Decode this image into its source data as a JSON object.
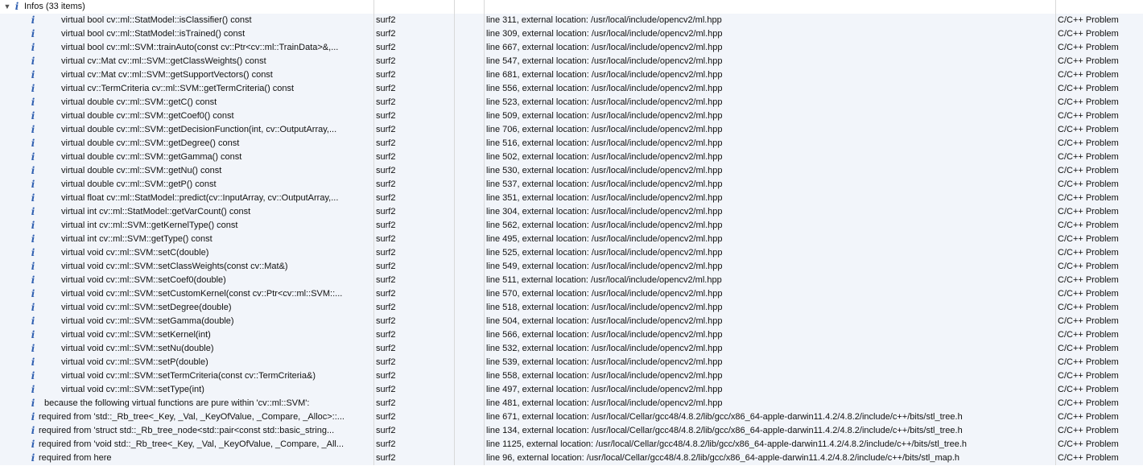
{
  "group": {
    "icon": "info-icon",
    "label": "Infos (33 items)",
    "expanded": true
  },
  "items": [
    {
      "description": "virtual bool cv::ml::StatModel::isClassifier() const",
      "resource": "surf2",
      "path": "",
      "location": "line 311, external location: /usr/local/include/opencv2/ml.hpp",
      "type": "C/C++ Problem",
      "indent": 2
    },
    {
      "description": "virtual bool cv::ml::StatModel::isTrained() const",
      "resource": "surf2",
      "path": "",
      "location": "line 309, external location: /usr/local/include/opencv2/ml.hpp",
      "type": "C/C++ Problem",
      "indent": 2
    },
    {
      "description": "virtual bool cv::ml::SVM::trainAuto(const cv::Ptr<cv::ml::TrainData>&,...",
      "resource": "surf2",
      "path": "",
      "location": "line 667, external location: /usr/local/include/opencv2/ml.hpp",
      "type": "C/C++ Problem",
      "indent": 2
    },
    {
      "description": "virtual cv::Mat cv::ml::SVM::getClassWeights() const",
      "resource": "surf2",
      "path": "",
      "location": "line 547, external location: /usr/local/include/opencv2/ml.hpp",
      "type": "C/C++ Problem",
      "indent": 2
    },
    {
      "description": "virtual cv::Mat cv::ml::SVM::getSupportVectors() const",
      "resource": "surf2",
      "path": "",
      "location": "line 681, external location: /usr/local/include/opencv2/ml.hpp",
      "type": "C/C++ Problem",
      "indent": 2
    },
    {
      "description": "virtual cv::TermCriteria cv::ml::SVM::getTermCriteria() const",
      "resource": "surf2",
      "path": "",
      "location": "line 556, external location: /usr/local/include/opencv2/ml.hpp",
      "type": "C/C++ Problem",
      "indent": 2
    },
    {
      "description": "virtual double cv::ml::SVM::getC() const",
      "resource": "surf2",
      "path": "",
      "location": "line 523, external location: /usr/local/include/opencv2/ml.hpp",
      "type": "C/C++ Problem",
      "indent": 2
    },
    {
      "description": "virtual double cv::ml::SVM::getCoef0() const",
      "resource": "surf2",
      "path": "",
      "location": "line 509, external location: /usr/local/include/opencv2/ml.hpp",
      "type": "C/C++ Problem",
      "indent": 2
    },
    {
      "description": "virtual double cv::ml::SVM::getDecisionFunction(int, cv::OutputArray,...",
      "resource": "surf2",
      "path": "",
      "location": "line 706, external location: /usr/local/include/opencv2/ml.hpp",
      "type": "C/C++ Problem",
      "indent": 2
    },
    {
      "description": "virtual double cv::ml::SVM::getDegree() const",
      "resource": "surf2",
      "path": "",
      "location": "line 516, external location: /usr/local/include/opencv2/ml.hpp",
      "type": "C/C++ Problem",
      "indent": 2
    },
    {
      "description": "virtual double cv::ml::SVM::getGamma() const",
      "resource": "surf2",
      "path": "",
      "location": "line 502, external location: /usr/local/include/opencv2/ml.hpp",
      "type": "C/C++ Problem",
      "indent": 2
    },
    {
      "description": "virtual double cv::ml::SVM::getNu() const",
      "resource": "surf2",
      "path": "",
      "location": "line 530, external location: /usr/local/include/opencv2/ml.hpp",
      "type": "C/C++ Problem",
      "indent": 2
    },
    {
      "description": "virtual double cv::ml::SVM::getP() const",
      "resource": "surf2",
      "path": "",
      "location": "line 537, external location: /usr/local/include/opencv2/ml.hpp",
      "type": "C/C++ Problem",
      "indent": 2
    },
    {
      "description": "virtual float cv::ml::StatModel::predict(cv::InputArray, cv::OutputArray,...",
      "resource": "surf2",
      "path": "",
      "location": "line 351, external location: /usr/local/include/opencv2/ml.hpp",
      "type": "C/C++ Problem",
      "indent": 2
    },
    {
      "description": "virtual int cv::ml::StatModel::getVarCount() const",
      "resource": "surf2",
      "path": "",
      "location": "line 304, external location: /usr/local/include/opencv2/ml.hpp",
      "type": "C/C++ Problem",
      "indent": 2
    },
    {
      "description": "virtual int cv::ml::SVM::getKernelType() const",
      "resource": "surf2",
      "path": "",
      "location": "line 562, external location: /usr/local/include/opencv2/ml.hpp",
      "type": "C/C++ Problem",
      "indent": 2
    },
    {
      "description": "virtual int cv::ml::SVM::getType() const",
      "resource": "surf2",
      "path": "",
      "location": "line 495, external location: /usr/local/include/opencv2/ml.hpp",
      "type": "C/C++ Problem",
      "indent": 2
    },
    {
      "description": "virtual void cv::ml::SVM::setC(double)",
      "resource": "surf2",
      "path": "",
      "location": "line 525, external location: /usr/local/include/opencv2/ml.hpp",
      "type": "C/C++ Problem",
      "indent": 2
    },
    {
      "description": "virtual void cv::ml::SVM::setClassWeights(const cv::Mat&)",
      "resource": "surf2",
      "path": "",
      "location": "line 549, external location: /usr/local/include/opencv2/ml.hpp",
      "type": "C/C++ Problem",
      "indent": 2
    },
    {
      "description": "virtual void cv::ml::SVM::setCoef0(double)",
      "resource": "surf2",
      "path": "",
      "location": "line 511, external location: /usr/local/include/opencv2/ml.hpp",
      "type": "C/C++ Problem",
      "indent": 2
    },
    {
      "description": "virtual void cv::ml::SVM::setCustomKernel(const cv::Ptr<cv::ml::SVM::...",
      "resource": "surf2",
      "path": "",
      "location": "line 570, external location: /usr/local/include/opencv2/ml.hpp",
      "type": "C/C++ Problem",
      "indent": 2
    },
    {
      "description": "virtual void cv::ml::SVM::setDegree(double)",
      "resource": "surf2",
      "path": "",
      "location": "line 518, external location: /usr/local/include/opencv2/ml.hpp",
      "type": "C/C++ Problem",
      "indent": 2
    },
    {
      "description": "virtual void cv::ml::SVM::setGamma(double)",
      "resource": "surf2",
      "path": "",
      "location": "line 504, external location: /usr/local/include/opencv2/ml.hpp",
      "type": "C/C++ Problem",
      "indent": 2
    },
    {
      "description": "virtual void cv::ml::SVM::setKernel(int)",
      "resource": "surf2",
      "path": "",
      "location": "line 566, external location: /usr/local/include/opencv2/ml.hpp",
      "type": "C/C++ Problem",
      "indent": 2
    },
    {
      "description": "virtual void cv::ml::SVM::setNu(double)",
      "resource": "surf2",
      "path": "",
      "location": "line 532, external location: /usr/local/include/opencv2/ml.hpp",
      "type": "C/C++ Problem",
      "indent": 2
    },
    {
      "description": "virtual void cv::ml::SVM::setP(double)",
      "resource": "surf2",
      "path": "",
      "location": "line 539, external location: /usr/local/include/opencv2/ml.hpp",
      "type": "C/C++ Problem",
      "indent": 2
    },
    {
      "description": "virtual void cv::ml::SVM::setTermCriteria(const cv::TermCriteria&)",
      "resource": "surf2",
      "path": "",
      "location": "line 558, external location: /usr/local/include/opencv2/ml.hpp",
      "type": "C/C++ Problem",
      "indent": 2
    },
    {
      "description": "virtual void cv::ml::SVM::setType(int)",
      "resource": "surf2",
      "path": "",
      "location": "line 497, external location: /usr/local/include/opencv2/ml.hpp",
      "type": "C/C++ Problem",
      "indent": 2
    },
    {
      "description": "because the following virtual functions are pure within 'cv::ml::SVM':",
      "resource": "surf2",
      "path": "",
      "location": "line 481, external location: /usr/local/include/opencv2/ml.hpp",
      "type": "C/C++ Problem",
      "indent": 1
    },
    {
      "description": "required from 'std::_Rb_tree<_Key, _Val, _KeyOfValue, _Compare, _Alloc>::...",
      "resource": "surf2",
      "path": "",
      "location": "line 671, external location: /usr/local/Cellar/gcc48/4.8.2/lib/gcc/x86_64-apple-darwin11.4.2/4.8.2/include/c++/bits/stl_tree.h",
      "type": "C/C++ Problem",
      "indent": 0
    },
    {
      "description": "required from 'struct std::_Rb_tree_node<std::pair<const std::basic_string...",
      "resource": "surf2",
      "path": "",
      "location": "line 134, external location: /usr/local/Cellar/gcc48/4.8.2/lib/gcc/x86_64-apple-darwin11.4.2/4.8.2/include/c++/bits/stl_tree.h",
      "type": "C/C++ Problem",
      "indent": 0
    },
    {
      "description": "required from 'void std::_Rb_tree<_Key, _Val, _KeyOfValue, _Compare, _All...",
      "resource": "surf2",
      "path": "",
      "location": "line 1125, external location: /usr/local/Cellar/gcc48/4.8.2/lib/gcc/x86_64-apple-darwin11.4.2/4.8.2/include/c++/bits/stl_tree.h",
      "type": "C/C++ Problem",
      "indent": 0
    },
    {
      "description": "required from here",
      "resource": "surf2",
      "path": "",
      "location": "line 96, external location: /usr/local/Cellar/gcc48/4.8.2/lib/gcc/x86_64-apple-darwin11.4.2/4.8.2/include/c++/bits/stl_map.h",
      "type": "C/C++ Problem",
      "indent": 0
    }
  ],
  "colors": {
    "info_icon": "#2f5fb0",
    "stripe": "#f2f5fa",
    "grid": "#d9d9d9"
  }
}
